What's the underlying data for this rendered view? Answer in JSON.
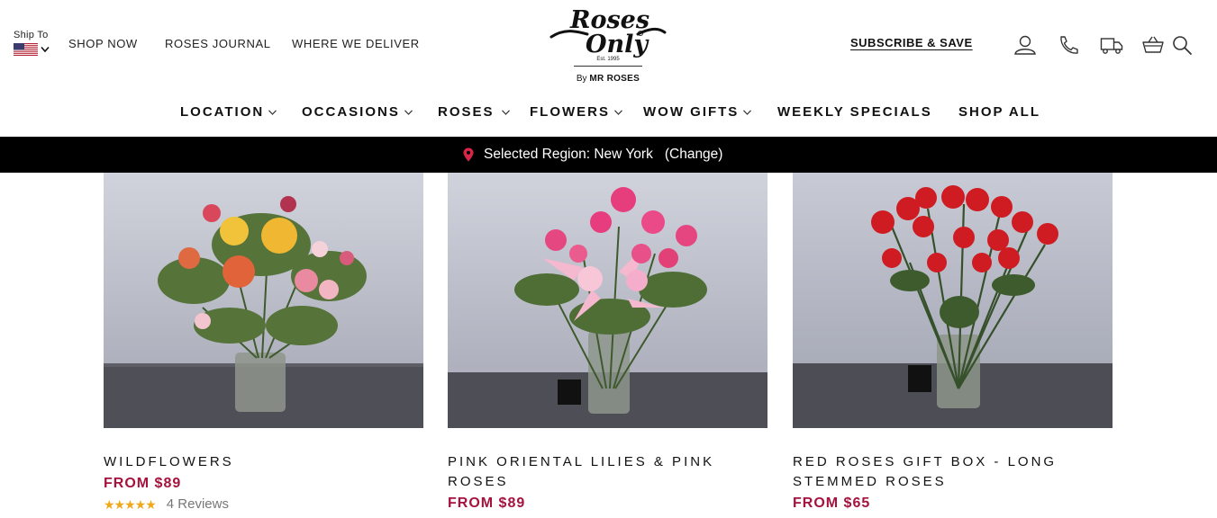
{
  "header": {
    "ship_to_label": "Ship To",
    "util_links": {
      "shop_now": "SHOP NOW",
      "journal": "ROSES JOURNAL",
      "deliver": "WHERE WE DELIVER"
    },
    "logo": {
      "est": "Est. 1995",
      "by": "By",
      "brand": "MR ROSES"
    },
    "subscribe": "SUBSCRIBE & SAVE",
    "icons": [
      "account-icon",
      "phone-icon",
      "delivery-truck-icon",
      "basket-icon",
      "search-icon"
    ]
  },
  "nav": {
    "location": "LOCATION",
    "occasions": "OCCASIONS",
    "roses": "ROSES",
    "flowers": "FLOWERS",
    "wow_gifts": "WOW GIFTS",
    "weekly_specials": "WEEKLY SPECIALS",
    "shop_all": "SHOP ALL"
  },
  "region": {
    "text": "Selected Region: New York",
    "change": "(Change)"
  },
  "products": [
    {
      "name": "WILDFLOWERS",
      "price": "FROM $89",
      "rating": 4.5,
      "reviews": "4 Reviews"
    },
    {
      "name": "PINK ORIENTAL LILIES & PINK ROSES",
      "price": "FROM $89"
    },
    {
      "name": "RED ROSES GIFT BOX - LONG STEMMED ROSES",
      "price": "FROM $65"
    }
  ],
  "colors": {
    "price": "#a6123e",
    "region_bar": "#000000",
    "star": "#f0a81b"
  }
}
